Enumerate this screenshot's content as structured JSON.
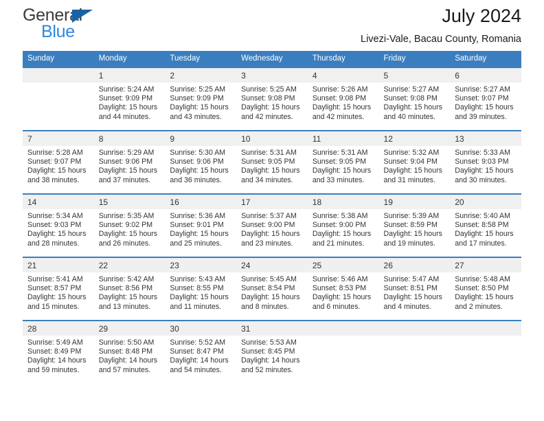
{
  "brand": {
    "line1": "General",
    "line2": "Blue",
    "triangle_color": "#1763a6",
    "blue_text_color": "#2e86de"
  },
  "header": {
    "title": "July 2024",
    "subtitle": "Livezi-Vale, Bacau County, Romania"
  },
  "theme": {
    "header_row_bg": "#3a7ebf",
    "header_row_text": "#ffffff",
    "daynum_bg": "#f0f0f0",
    "row_border": "#3a7ebf",
    "body_text": "#333333"
  },
  "calendar": {
    "weekday_headers": [
      "Sunday",
      "Monday",
      "Tuesday",
      "Wednesday",
      "Thursday",
      "Friday",
      "Saturday"
    ],
    "weeks": [
      [
        {
          "day": "",
          "sunrise": "",
          "sunset": "",
          "daylight_line1": "",
          "daylight_line2": ""
        },
        {
          "day": "1",
          "sunrise": "Sunrise: 5:24 AM",
          "sunset": "Sunset: 9:09 PM",
          "daylight_line1": "Daylight: 15 hours",
          "daylight_line2": "and 44 minutes."
        },
        {
          "day": "2",
          "sunrise": "Sunrise: 5:25 AM",
          "sunset": "Sunset: 9:09 PM",
          "daylight_line1": "Daylight: 15 hours",
          "daylight_line2": "and 43 minutes."
        },
        {
          "day": "3",
          "sunrise": "Sunrise: 5:25 AM",
          "sunset": "Sunset: 9:08 PM",
          "daylight_line1": "Daylight: 15 hours",
          "daylight_line2": "and 42 minutes."
        },
        {
          "day": "4",
          "sunrise": "Sunrise: 5:26 AM",
          "sunset": "Sunset: 9:08 PM",
          "daylight_line1": "Daylight: 15 hours",
          "daylight_line2": "and 42 minutes."
        },
        {
          "day": "5",
          "sunrise": "Sunrise: 5:27 AM",
          "sunset": "Sunset: 9:08 PM",
          "daylight_line1": "Daylight: 15 hours",
          "daylight_line2": "and 40 minutes."
        },
        {
          "day": "6",
          "sunrise": "Sunrise: 5:27 AM",
          "sunset": "Sunset: 9:07 PM",
          "daylight_line1": "Daylight: 15 hours",
          "daylight_line2": "and 39 minutes."
        }
      ],
      [
        {
          "day": "7",
          "sunrise": "Sunrise: 5:28 AM",
          "sunset": "Sunset: 9:07 PM",
          "daylight_line1": "Daylight: 15 hours",
          "daylight_line2": "and 38 minutes."
        },
        {
          "day": "8",
          "sunrise": "Sunrise: 5:29 AM",
          "sunset": "Sunset: 9:06 PM",
          "daylight_line1": "Daylight: 15 hours",
          "daylight_line2": "and 37 minutes."
        },
        {
          "day": "9",
          "sunrise": "Sunrise: 5:30 AM",
          "sunset": "Sunset: 9:06 PM",
          "daylight_line1": "Daylight: 15 hours",
          "daylight_line2": "and 36 minutes."
        },
        {
          "day": "10",
          "sunrise": "Sunrise: 5:31 AM",
          "sunset": "Sunset: 9:05 PM",
          "daylight_line1": "Daylight: 15 hours",
          "daylight_line2": "and 34 minutes."
        },
        {
          "day": "11",
          "sunrise": "Sunrise: 5:31 AM",
          "sunset": "Sunset: 9:05 PM",
          "daylight_line1": "Daylight: 15 hours",
          "daylight_line2": "and 33 minutes."
        },
        {
          "day": "12",
          "sunrise": "Sunrise: 5:32 AM",
          "sunset": "Sunset: 9:04 PM",
          "daylight_line1": "Daylight: 15 hours",
          "daylight_line2": "and 31 minutes."
        },
        {
          "day": "13",
          "sunrise": "Sunrise: 5:33 AM",
          "sunset": "Sunset: 9:03 PM",
          "daylight_line1": "Daylight: 15 hours",
          "daylight_line2": "and 30 minutes."
        }
      ],
      [
        {
          "day": "14",
          "sunrise": "Sunrise: 5:34 AM",
          "sunset": "Sunset: 9:03 PM",
          "daylight_line1": "Daylight: 15 hours",
          "daylight_line2": "and 28 minutes."
        },
        {
          "day": "15",
          "sunrise": "Sunrise: 5:35 AM",
          "sunset": "Sunset: 9:02 PM",
          "daylight_line1": "Daylight: 15 hours",
          "daylight_line2": "and 26 minutes."
        },
        {
          "day": "16",
          "sunrise": "Sunrise: 5:36 AM",
          "sunset": "Sunset: 9:01 PM",
          "daylight_line1": "Daylight: 15 hours",
          "daylight_line2": "and 25 minutes."
        },
        {
          "day": "17",
          "sunrise": "Sunrise: 5:37 AM",
          "sunset": "Sunset: 9:00 PM",
          "daylight_line1": "Daylight: 15 hours",
          "daylight_line2": "and 23 minutes."
        },
        {
          "day": "18",
          "sunrise": "Sunrise: 5:38 AM",
          "sunset": "Sunset: 9:00 PM",
          "daylight_line1": "Daylight: 15 hours",
          "daylight_line2": "and 21 minutes."
        },
        {
          "day": "19",
          "sunrise": "Sunrise: 5:39 AM",
          "sunset": "Sunset: 8:59 PM",
          "daylight_line1": "Daylight: 15 hours",
          "daylight_line2": "and 19 minutes."
        },
        {
          "day": "20",
          "sunrise": "Sunrise: 5:40 AM",
          "sunset": "Sunset: 8:58 PM",
          "daylight_line1": "Daylight: 15 hours",
          "daylight_line2": "and 17 minutes."
        }
      ],
      [
        {
          "day": "21",
          "sunrise": "Sunrise: 5:41 AM",
          "sunset": "Sunset: 8:57 PM",
          "daylight_line1": "Daylight: 15 hours",
          "daylight_line2": "and 15 minutes."
        },
        {
          "day": "22",
          "sunrise": "Sunrise: 5:42 AM",
          "sunset": "Sunset: 8:56 PM",
          "daylight_line1": "Daylight: 15 hours",
          "daylight_line2": "and 13 minutes."
        },
        {
          "day": "23",
          "sunrise": "Sunrise: 5:43 AM",
          "sunset": "Sunset: 8:55 PM",
          "daylight_line1": "Daylight: 15 hours",
          "daylight_line2": "and 11 minutes."
        },
        {
          "day": "24",
          "sunrise": "Sunrise: 5:45 AM",
          "sunset": "Sunset: 8:54 PM",
          "daylight_line1": "Daylight: 15 hours",
          "daylight_line2": "and 8 minutes."
        },
        {
          "day": "25",
          "sunrise": "Sunrise: 5:46 AM",
          "sunset": "Sunset: 8:53 PM",
          "daylight_line1": "Daylight: 15 hours",
          "daylight_line2": "and 6 minutes."
        },
        {
          "day": "26",
          "sunrise": "Sunrise: 5:47 AM",
          "sunset": "Sunset: 8:51 PM",
          "daylight_line1": "Daylight: 15 hours",
          "daylight_line2": "and 4 minutes."
        },
        {
          "day": "27",
          "sunrise": "Sunrise: 5:48 AM",
          "sunset": "Sunset: 8:50 PM",
          "daylight_line1": "Daylight: 15 hours",
          "daylight_line2": "and 2 minutes."
        }
      ],
      [
        {
          "day": "28",
          "sunrise": "Sunrise: 5:49 AM",
          "sunset": "Sunset: 8:49 PM",
          "daylight_line1": "Daylight: 14 hours",
          "daylight_line2": "and 59 minutes."
        },
        {
          "day": "29",
          "sunrise": "Sunrise: 5:50 AM",
          "sunset": "Sunset: 8:48 PM",
          "daylight_line1": "Daylight: 14 hours",
          "daylight_line2": "and 57 minutes."
        },
        {
          "day": "30",
          "sunrise": "Sunrise: 5:52 AM",
          "sunset": "Sunset: 8:47 PM",
          "daylight_line1": "Daylight: 14 hours",
          "daylight_line2": "and 54 minutes."
        },
        {
          "day": "31",
          "sunrise": "Sunrise: 5:53 AM",
          "sunset": "Sunset: 8:45 PM",
          "daylight_line1": "Daylight: 14 hours",
          "daylight_line2": "and 52 minutes."
        },
        {
          "day": "",
          "sunrise": "",
          "sunset": "",
          "daylight_line1": "",
          "daylight_line2": ""
        },
        {
          "day": "",
          "sunrise": "",
          "sunset": "",
          "daylight_line1": "",
          "daylight_line2": ""
        },
        {
          "day": "",
          "sunrise": "",
          "sunset": "",
          "daylight_line1": "",
          "daylight_line2": ""
        }
      ]
    ]
  }
}
